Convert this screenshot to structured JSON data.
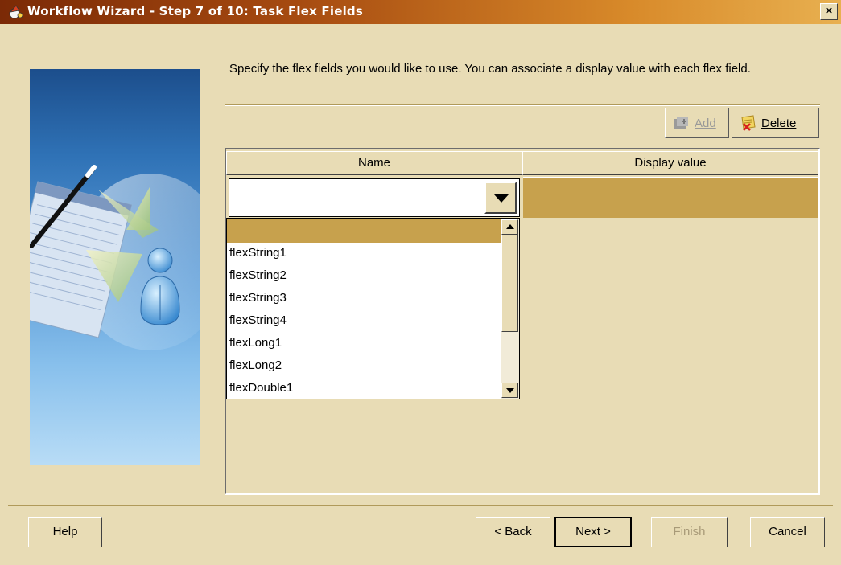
{
  "window": {
    "title": "Workflow Wizard - Step 7 of 10: Task Flex Fields",
    "close_glyph": "×"
  },
  "instructions": "Specify the flex fields you would like to use. You can associate a display value with each flex field.",
  "toolbar": {
    "add_label": "Add",
    "delete_label": "Delete"
  },
  "table": {
    "columns": [
      "Name",
      "Display value"
    ],
    "rows": [
      {
        "name": "",
        "display_value": ""
      }
    ]
  },
  "name_dropdown": {
    "options": [
      "",
      "flexString1",
      "flexString2",
      "flexString3",
      "flexString4",
      "flexLong1",
      "flexLong2",
      "flexDouble1"
    ],
    "highlighted_index": 0
  },
  "buttons": {
    "help": "Help",
    "back": "< Back",
    "next": "Next >",
    "finish": "Finish",
    "cancel": "Cancel"
  },
  "colors": {
    "dialog_bg": "#e8dcb5",
    "selection": "#c7a14d",
    "title_gradient_start": "#7b2a06",
    "title_gradient_end": "#e8b050"
  },
  "icons": {
    "title": "wizard-hat-icon",
    "add": "add-row-icon",
    "delete": "delete-row-icon"
  }
}
